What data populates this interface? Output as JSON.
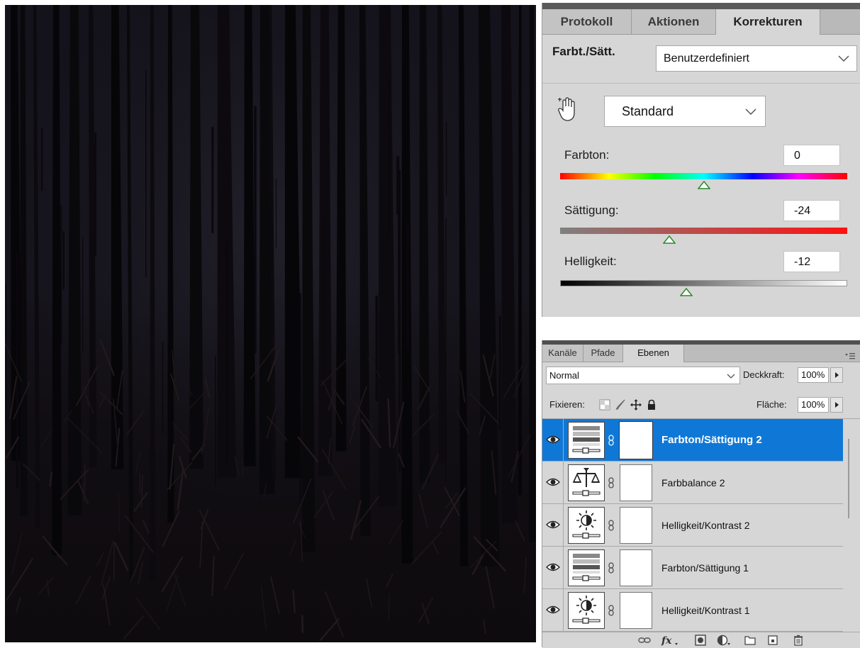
{
  "canvas": {
    "photo_description_icon": "dark-forest-photo"
  },
  "adjustments_panel": {
    "tabs": [
      {
        "label": "Protokoll",
        "active": false
      },
      {
        "label": "Aktionen",
        "active": false
      },
      {
        "label": "Korrekturen",
        "active": true
      }
    ],
    "title": "Farbt./Sätt.",
    "preset": "Benutzerdefiniert",
    "channel": "Standard",
    "hue": {
      "label": "Farbton:",
      "value": "0",
      "level": 0.5
    },
    "saturation": {
      "label": "Sättigung:",
      "value": "-24",
      "level": 0.38
    },
    "lightness": {
      "label": "Helligkeit:",
      "value": "-12",
      "level": 0.44
    }
  },
  "layers_panel": {
    "tabs": [
      {
        "label": "Kanäle",
        "active": false
      },
      {
        "label": "Pfade",
        "active": false
      },
      {
        "label": "Ebenen",
        "active": true
      }
    ],
    "blend_mode": "Normal",
    "opacity_label": "Deckkraft:",
    "opacity": "100%",
    "lock_label": "Fixieren:",
    "fill_label": "Fläche:",
    "fill": "100%",
    "layers": [
      {
        "name": "Farbton/Sättigung 2",
        "type": "hue-saturation",
        "selected": true
      },
      {
        "name": "Farbbalance 2",
        "type": "color-balance",
        "selected": false
      },
      {
        "name": "Helligkeit/Kontrast 2",
        "type": "brightness-contrast",
        "selected": false
      },
      {
        "name": "Farbton/Sättigung 1",
        "type": "hue-saturation",
        "selected": false
      },
      {
        "name": "Helligkeit/Kontrast 1",
        "type": "brightness-contrast",
        "selected": false
      }
    ]
  },
  "colors": {
    "selection": "#0f78d7",
    "panel_bg": "#d6d6d6"
  }
}
